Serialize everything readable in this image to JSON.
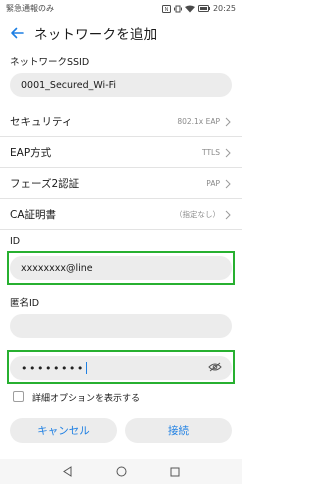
{
  "status_bar": {
    "left_text": "緊急通報のみ",
    "time": "20:25"
  },
  "header": {
    "title": "ネットワークを追加"
  },
  "ssid": {
    "label": "ネットワークSSID",
    "value": "0001_Secured_Wi-Fi"
  },
  "settings": [
    {
      "label": "セキュリティ",
      "value": "802.1x EAP"
    },
    {
      "label": "EAP方式",
      "value": "TTLS"
    },
    {
      "label": "フェーズ2認証",
      "value": "PAP"
    },
    {
      "label": "CA証明書",
      "value": "（指定なし）"
    }
  ],
  "identity": {
    "label": "ID",
    "value": "xxxxxxxx@line"
  },
  "anonymous_identity": {
    "label": "匿名ID",
    "value": ""
  },
  "password": {
    "value": "••••••••"
  },
  "advanced_option": {
    "label": "詳細オプションを表示する",
    "checked": false
  },
  "buttons": {
    "cancel": "キャンセル",
    "connect": "接続"
  },
  "colors": {
    "accent": "#1d7fe3",
    "highlight": "#27b030",
    "field_bg": "#ececec"
  }
}
